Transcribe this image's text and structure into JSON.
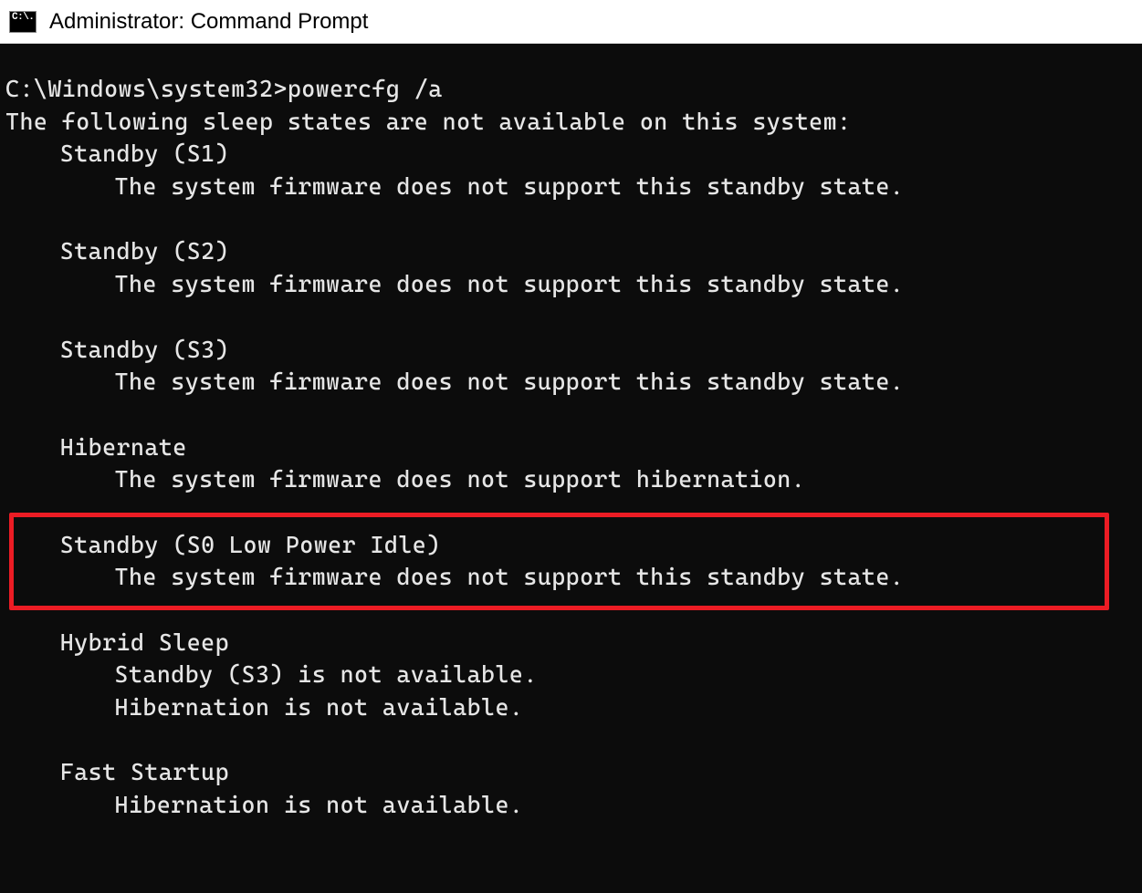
{
  "window": {
    "title": "Administrator: Command Prompt",
    "icon_glyph": "C:\\."
  },
  "terminal": {
    "prompt": "C:\\Windows\\system32>",
    "command": "powercfg /a",
    "heading": "The following sleep states are not available on this system:",
    "states": [
      {
        "name": "Standby (S1)",
        "reasons": [
          "The system firmware does not support this standby state."
        ]
      },
      {
        "name": "Standby (S2)",
        "reasons": [
          "The system firmware does not support this standby state."
        ]
      },
      {
        "name": "Standby (S3)",
        "reasons": [
          "The system firmware does not support this standby state."
        ]
      },
      {
        "name": "Hibernate",
        "reasons": [
          "The system firmware does not support hibernation."
        ]
      },
      {
        "name": "Standby (S0 Low Power Idle)",
        "reasons": [
          "The system firmware does not support this standby state."
        ],
        "highlighted": true
      },
      {
        "name": "Hybrid Sleep",
        "reasons": [
          "Standby (S3) is not available.",
          "Hibernation is not available."
        ]
      },
      {
        "name": "Fast Startup",
        "reasons": [
          "Hibernation is not available."
        ]
      }
    ]
  },
  "annotation": {
    "highlight_color": "#ec1c24"
  }
}
